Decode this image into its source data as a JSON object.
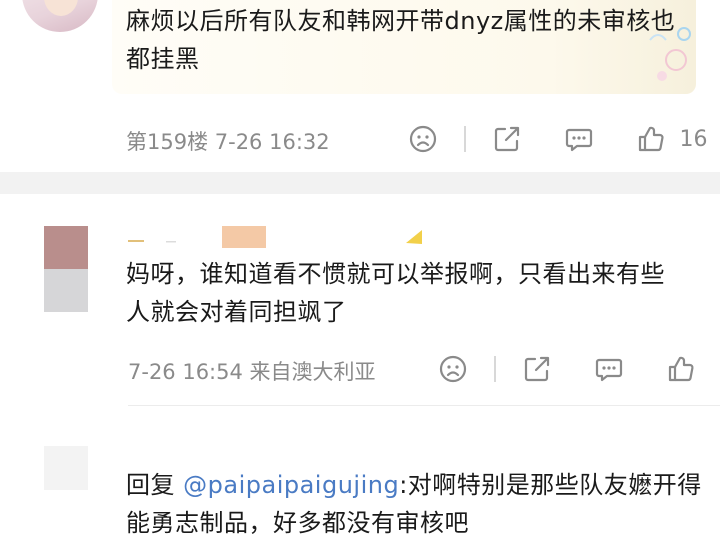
{
  "comments": [
    {
      "text": "麻烦以后所有队友和韩网开带dnyz属性的未审核也都挂黑",
      "meta": "第159楼 7-26 16:32",
      "likes": "16"
    },
    {
      "text": "妈呀，谁知道看不惯就可以举报啊，只看出来有些人就会对着同担飒了",
      "meta": "7-26 16:54 来自澳大利亚"
    },
    {
      "reply_prefix": "回复 ",
      "mention": "@paipaipaigujing",
      "text": ":对啊特别是那些队友嬷开得能勇志制品，好多都没有审核吧"
    }
  ],
  "icons": [
    "sad-face-icon",
    "share-icon",
    "comment-icon",
    "thumbs-up-icon"
  ],
  "colors": {
    "mention": "#4a7bc4",
    "meta": "#8a8a8a",
    "text": "#1a1a1a"
  }
}
